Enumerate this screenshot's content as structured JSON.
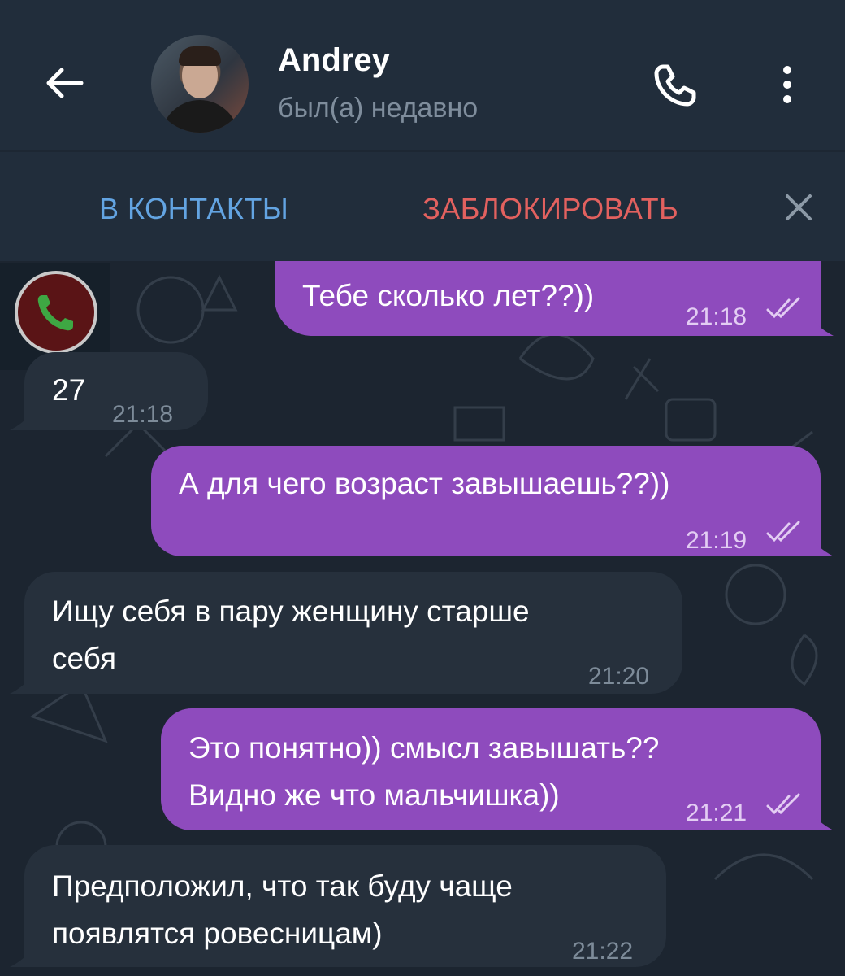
{
  "header": {
    "contact_name": "Andrey",
    "status": "был(а) недавно",
    "icons": [
      "arrow-left-icon",
      "avatar",
      "phone-icon",
      "more-vertical-icon"
    ]
  },
  "action_bar": {
    "add_contact": "В КОНТАКТЫ",
    "block": "ЗАБЛОКИРОВАТЬ",
    "close_icon": "close-icon"
  },
  "colors": {
    "header_bg": "#212d3b",
    "chat_bg": "#1c2530",
    "outgoing_bubble": "#8e4bbd",
    "incoming_bubble": "#26303c",
    "contacts_blue": "#63a4e2",
    "block_red": "#e2615f"
  },
  "messages": [
    {
      "direction": "out",
      "lines": [
        "Тебе сколько лет??))"
      ],
      "time": "21:18",
      "read": true
    },
    {
      "direction": "in",
      "lines": [
        "27"
      ],
      "time": "21:18"
    },
    {
      "direction": "out",
      "lines": [
        "А для чего возраст завышаешь??))"
      ],
      "time": "21:19",
      "read": true
    },
    {
      "direction": "in",
      "lines": [
        "Ищу себя в пару женщину старше",
        "себя"
      ],
      "time": "21:20"
    },
    {
      "direction": "out",
      "lines": [
        "Это понятно)) смысл завышать??",
        "Видно же что мальчишка))"
      ],
      "time": "21:21",
      "read": true
    },
    {
      "direction": "in",
      "lines": [
        "Предположил, что так буду чаще",
        "появлятся ровесницам)"
      ],
      "time": "21:22"
    }
  ],
  "overlay_icon": "call-recorder-icon"
}
